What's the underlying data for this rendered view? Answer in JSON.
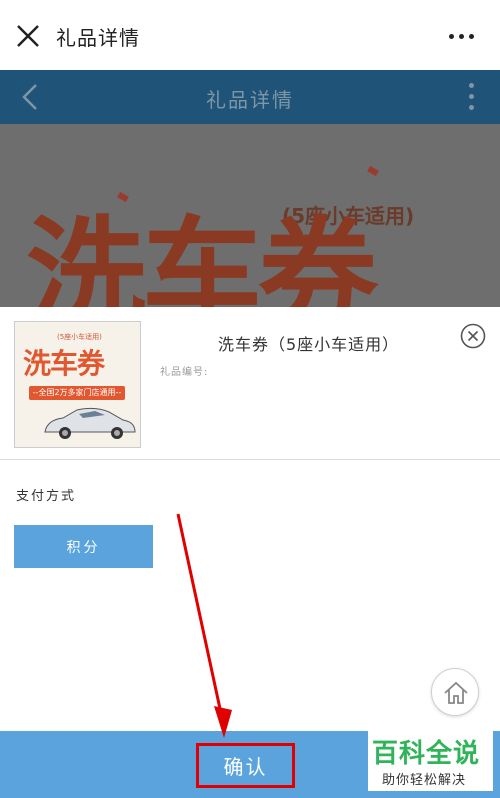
{
  "appbar": {
    "title": "礼品详情",
    "close_icon": "close-icon",
    "more_icon": "more-dots-icon"
  },
  "webbar": {
    "title": "礼品详情",
    "back_icon": "chevron-left-icon",
    "more_icon": "vertical-dots-icon"
  },
  "banner": {
    "subtitle": "(5座小车适用)",
    "headline": "洗车券"
  },
  "product": {
    "name": "洗车券（5座小车适用）",
    "code_label": "礼品编号:",
    "thumb": {
      "small": "(5座小车适用)",
      "headline": "洗车券",
      "band": "--全国2万多家门店通用--"
    }
  },
  "payment": {
    "label": "支付方式",
    "option": "积分"
  },
  "footer": {
    "confirm_label": "确认"
  },
  "watermark": {
    "brand": "百科全说",
    "tagline": "助你轻松解决"
  },
  "colors": {
    "header_blue": "#1f5377",
    "accent_blue": "#5aa3dc",
    "annotation_red": "#e00000",
    "brand_green": "#2fb45a"
  }
}
